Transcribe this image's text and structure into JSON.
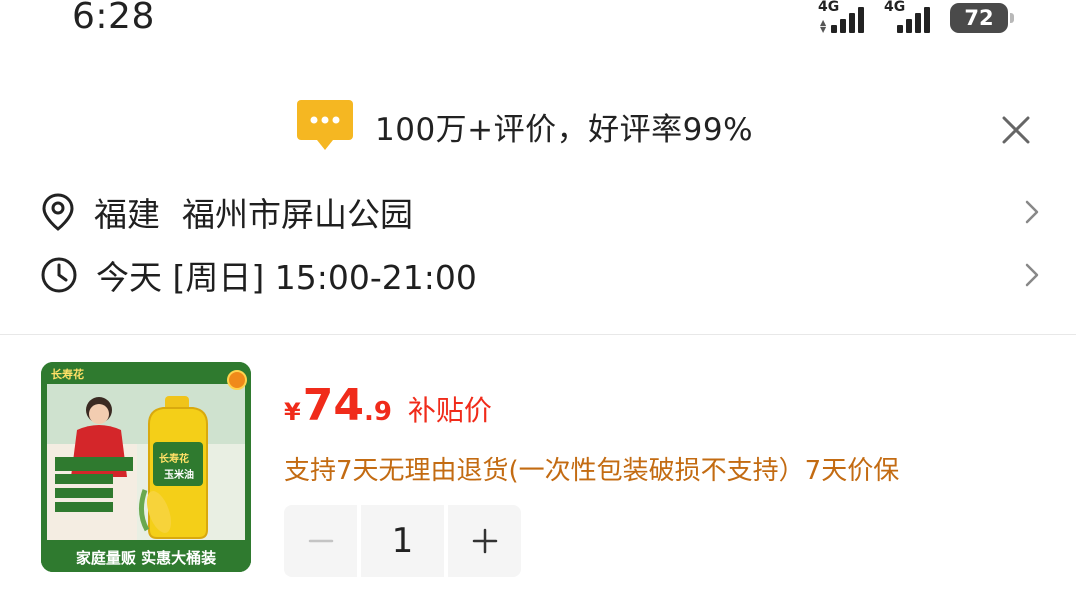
{
  "status_bar": {
    "time": "6:28",
    "network_1": "4G",
    "network_2": "4G",
    "battery": "72"
  },
  "review_banner": {
    "icon": "chat-bubble-icon",
    "text": "100万+评价，好评率99%"
  },
  "delivery": {
    "province": "福建",
    "address": "福州市屏山公园",
    "time_text": "今天 [周日] 15:00-21:00"
  },
  "product": {
    "image_caption": "家庭量贩 实惠大桶装",
    "image_brand": "长寿花",
    "image_oil_label": "玉米油",
    "price_symbol": "¥",
    "price_integer": "74",
    "price_decimal": ".9",
    "price_tag": "补贴价",
    "guarantee": "支持7天无理由退货(一次性包装破损不支持）7天价保",
    "quantity": "1"
  },
  "colors": {
    "price_red": "#f02b1a",
    "guarantee_orange": "#c36b12",
    "banner_yellow": "#f5b722",
    "product_green": "#2e7d32"
  }
}
